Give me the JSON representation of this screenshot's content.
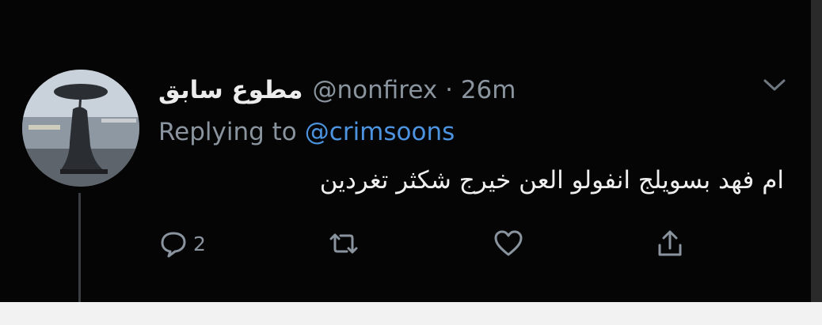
{
  "tweet": {
    "display_name": "مطوع سابق",
    "handle": "@nonfirex",
    "separator": "·",
    "time": "26m",
    "replying_prefix": "Replying to",
    "replying_to": "@crimsoons",
    "text": "ام فهد بسويلج انفولو العن خيرج شكثر تغردين",
    "reply_count": "2"
  },
  "icons": {
    "menu": "chevron-down-icon",
    "reply": "reply-bubble-icon",
    "retweet": "retweet-icon",
    "like": "heart-icon",
    "share": "share-icon"
  },
  "colors": {
    "background": "#050505",
    "primary_text": "#ececec",
    "secondary_text": "#8a949e",
    "link": "#4c93e0",
    "thread_line": "#3a3d41"
  }
}
